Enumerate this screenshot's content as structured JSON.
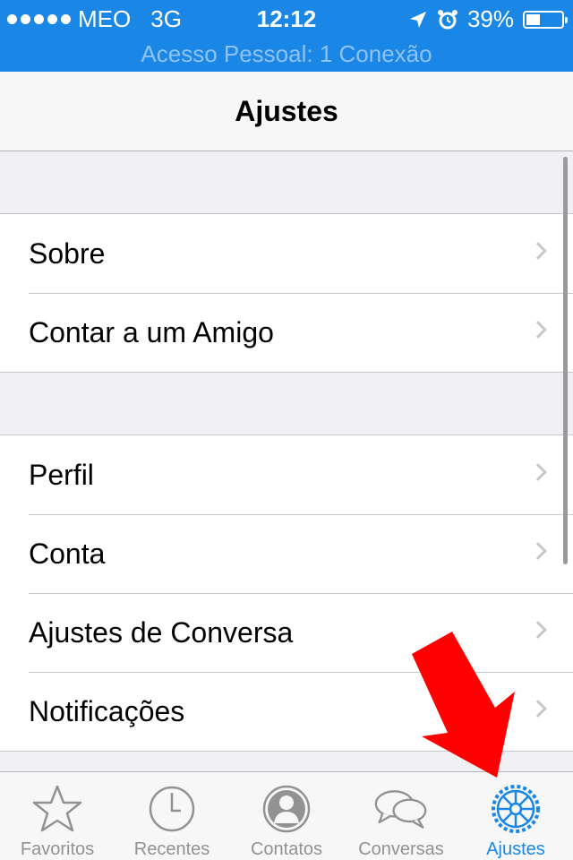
{
  "status_bar": {
    "carrier": "MEO",
    "network": "3G",
    "time": "12:12",
    "battery": "39%",
    "battery_level": 0.39,
    "icons": [
      "signal-dots-icon",
      "location-arrow-icon",
      "alarm-icon",
      "battery-icon"
    ]
  },
  "hotspot": {
    "label": "Acesso Pessoal: 1 Conexão"
  },
  "nav": {
    "title": "Ajustes"
  },
  "groups": [
    {
      "items": [
        {
          "label": "Sobre"
        },
        {
          "label": "Contar a um Amigo"
        }
      ]
    },
    {
      "items": [
        {
          "label": "Perfil"
        },
        {
          "label": "Conta"
        },
        {
          "label": "Ajustes de Conversa"
        },
        {
          "label": "Notificações"
        }
      ]
    }
  ],
  "tabs": [
    {
      "label": "Favoritos",
      "icon": "star-icon",
      "active": false
    },
    {
      "label": "Recentes",
      "icon": "clock-icon",
      "active": false
    },
    {
      "label": "Contatos",
      "icon": "contact-icon",
      "active": false
    },
    {
      "label": "Conversas",
      "icon": "chat-bubbles-icon",
      "active": false
    },
    {
      "label": "Ajustes",
      "icon": "gear-icon",
      "active": true
    }
  ],
  "colors": {
    "accent": "#1a87e6",
    "inactive_tab": "#929292",
    "annotation_arrow": "#ff0000"
  }
}
